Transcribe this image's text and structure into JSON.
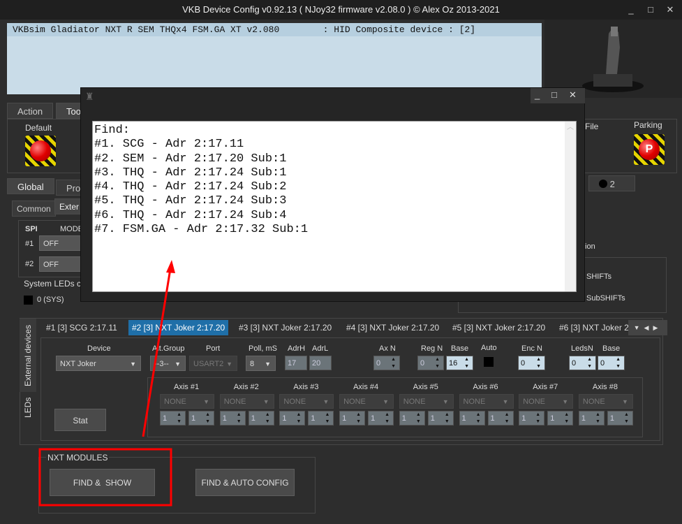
{
  "window": {
    "title": "VKB Device Config v0.92.13 ( NJoy32 firmware v2.08.0 ) © Alex Oz 2013-2021"
  },
  "device_list": {
    "rows": [
      "VKBsim Gladiator NXT R SEM THQx4 FSM.GA XT v2.080        : HID Composite device : [2]"
    ]
  },
  "action_tabs": [
    "Action",
    "Too"
  ],
  "toolbar": {
    "default_label": "Default",
    "file_label": "File",
    "parking_label": "Parking"
  },
  "main_tabs": [
    "Global",
    "Prof"
  ],
  "sub_tabs": [
    "Common",
    "Exter"
  ],
  "spi": {
    "header": "SPI",
    "mode_header": "MODE",
    "rows": [
      {
        "label": "#1",
        "value": "OFF"
      },
      {
        "label": "#2",
        "value": "OFF"
      }
    ]
  },
  "system_leds": {
    "title": "System LEDs c",
    "first": "0 (SYS)"
  },
  "right_panel": {
    "tab_label": "2",
    "option_label": "tion",
    "shifts": "SHIFTs",
    "subshifts": "SubSHIFTs"
  },
  "side_tabs": [
    "External devices",
    "LEDs"
  ],
  "device_tabs": [
    "#1 [3] SCG 2:17.11",
    "#2 [3] NXT Joker 2:17.20",
    "#3 [3] NXT Joker 2:17.20",
    "#4 [3] NXT Joker 2:17.20",
    "#5 [3] NXT Joker 2:17.20",
    "#6 [3] NXT Joker 2:"
  ],
  "active_device_tab": 1,
  "device_form": {
    "device_label": "Device",
    "device_value": "NXT Joker",
    "altgroup_label": "Alt.Group",
    "altgroup_value": "--3--",
    "port_label": "Port",
    "port_value": "USART2",
    "poll_label": "Poll, mS",
    "poll_value": "8",
    "adrh_label": "AdrH",
    "adrh_value": "17",
    "adrl_label": "AdrL",
    "adrl_value": "20",
    "axn_label": "Ax N",
    "axn_value": "0",
    "regn_label": "Reg N",
    "regn_value": "0",
    "base_label": "Base",
    "base_value": "16",
    "auto_label": "Auto",
    "encn_label": "Enc N",
    "encn_value": "0",
    "ledsn_label": "LedsN",
    "ledsn_value": "0",
    "base2_label": "Base",
    "base2_value": "0",
    "stat_label": "Stat",
    "axes": [
      {
        "label": "Axis #1",
        "value": "NONE",
        "a": "1",
        "b": "1"
      },
      {
        "label": "Axis #2",
        "value": "NONE",
        "a": "1",
        "b": "1"
      },
      {
        "label": "Axis #3",
        "value": "NONE",
        "a": "1",
        "b": "1"
      },
      {
        "label": "Axis #4",
        "value": "NONE",
        "a": "1",
        "b": "1"
      },
      {
        "label": "Axis #5",
        "value": "NONE",
        "a": "1",
        "b": "1"
      },
      {
        "label": "Axis #6",
        "value": "NONE",
        "a": "1",
        "b": "1"
      },
      {
        "label": "Axis #7",
        "value": "NONE",
        "a": "1",
        "b": "1"
      },
      {
        "label": "Axis #8",
        "value": "NONE",
        "a": "1",
        "b": "1"
      }
    ]
  },
  "nxt_modules": {
    "title": "NXT MODULES",
    "find_show": "FIND &  SHOW",
    "find_auto": "FIND & AUTO CONFIG"
  },
  "dialog": {
    "lines": [
      "Find:",
      "#1. SCG - Adr 2:17.11",
      "#2. SEM - Adr 2:17.20 Sub:1",
      "#3. THQ - Adr 2:17.24 Sub:1",
      "#4. THQ - Adr 2:17.24 Sub:2",
      "#5. THQ - Adr 2:17.24 Sub:3",
      "#6. THQ - Adr 2:17.24 Sub:4",
      "#7. FSM.GA - Adr 2:17.32 Sub:1"
    ]
  },
  "annotation_color": "#ff0000"
}
